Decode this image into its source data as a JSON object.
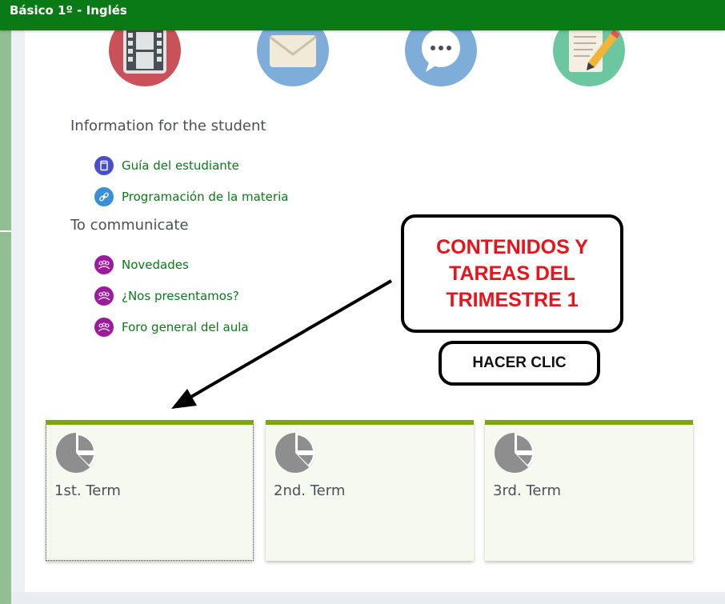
{
  "header": {
    "title": "Básico 1º - Inglés"
  },
  "top_icons": [
    {
      "name": "film-icon",
      "color": "#c9525a"
    },
    {
      "name": "envelope-icon",
      "color": "#7fadda"
    },
    {
      "name": "chat-bubble-icon",
      "color": "#7fadda"
    },
    {
      "name": "notepad-pencil-icon",
      "color": "#6cc6a0"
    }
  ],
  "sections": {
    "student": {
      "title": "Information for the student",
      "links": [
        {
          "label": "Guía del estudiante",
          "icon": "book-icon"
        },
        {
          "label": "Programación de la materia",
          "icon": "link-icon"
        }
      ]
    },
    "communicate": {
      "title": "To communicate",
      "links": [
        {
          "label": "Novedades",
          "icon": "forum-icon"
        },
        {
          "label": "¿Nos presentamos?",
          "icon": "forum-icon"
        },
        {
          "label": "Foro general del aula",
          "icon": "forum-icon"
        }
      ]
    }
  },
  "callout": {
    "text": "CONTENIDOS Y\nTAREAS DEL\nTRIMESTRE 1",
    "button_label": "HACER CLIC",
    "text_color": "#e8131b"
  },
  "terms": [
    {
      "label": "1st. Term",
      "icon": "pie-chart-icon"
    },
    {
      "label": "2nd. Term",
      "icon": "pie-chart-icon"
    },
    {
      "label": "3rd. Term",
      "icon": "pie-chart-icon"
    }
  ],
  "colors": {
    "header_bg": "#0a7a17",
    "link_text": "#0a7a17",
    "term_accent": "#7ea60c"
  }
}
